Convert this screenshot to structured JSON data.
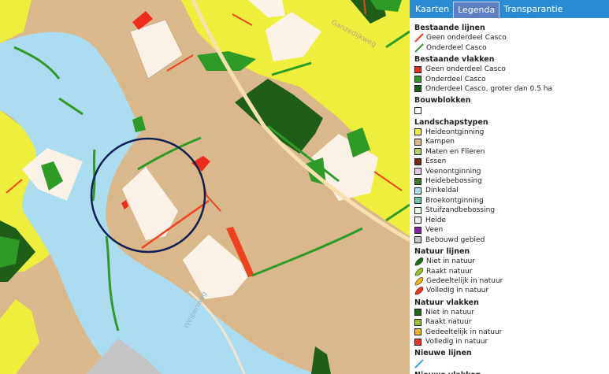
{
  "tabs": [
    {
      "label": "Kaarten",
      "active": false
    },
    {
      "label": "Legenda",
      "active": true
    },
    {
      "label": "Transparantie",
      "active": false
    }
  ],
  "map": {
    "road_labels": [
      "Ganzedijkweg",
      "Welpenweg"
    ],
    "colors": {
      "water": "#acdcf0",
      "kampen": "#d9b98b",
      "heideontginning": "#eeee3c",
      "bouwblok": "#faf2e6",
      "casco_green": "#2f9b27",
      "casco_dark": "#1f6b17",
      "not_casco": "#ef4320",
      "circle": "#0d1f55"
    }
  },
  "legend": {
    "bestaande_lijnen": {
      "title": "Bestaande lijnen",
      "items": [
        {
          "label": "Geen onderdeel Casco",
          "color": "#ef4320"
        },
        {
          "label": "Onderdeel Casco",
          "color": "#2f9b27"
        }
      ]
    },
    "bestaande_vlakken": {
      "title": "Bestaande vlakken",
      "items": [
        {
          "label": "Geen onderdeel Casco",
          "color": "#ef2b1c"
        },
        {
          "label": "Onderdeel Casco",
          "color": "#2f9b27"
        },
        {
          "label": "Onderdeel Casco, groter dan 0.5 ha",
          "color": "#1e5e17"
        }
      ]
    },
    "bouwblokken": {
      "title": "Bouwblokken",
      "items": [
        {
          "label": "",
          "color": "#ffffff"
        }
      ]
    },
    "landschapstypen": {
      "title": "Landschapstypen",
      "items": [
        {
          "label": "Heideontginning",
          "color": "#eeee3c"
        },
        {
          "label": "Kampen",
          "color": "#d9b98b"
        },
        {
          "label": "Maten en Flieren",
          "color": "#b3d16b"
        },
        {
          "label": "Essen",
          "color": "#7a2a14"
        },
        {
          "label": "Veenontginning",
          "color": "#e9c8e6"
        },
        {
          "label": "Heidebebossing",
          "color": "#3d7a2e"
        },
        {
          "label": "Dinkeldal",
          "color": "#acdcf0"
        },
        {
          "label": "Broekontginning",
          "color": "#6fc6a6"
        },
        {
          "label": "Stuifzandbebossing",
          "color": "#eaf6df"
        },
        {
          "label": "Heide",
          "color": "#f5e9f1"
        },
        {
          "label": "Veen",
          "color": "#8c1fb0"
        },
        {
          "label": "Bebouwd gebied",
          "color": "#c4c4c4"
        }
      ]
    },
    "natuur_lijnen": {
      "title": "Natuur lijnen",
      "items": [
        {
          "label": "Niet in natuur",
          "color": "#1f6b17"
        },
        {
          "label": "Raakt natuur",
          "color": "#9ac026"
        },
        {
          "label": "Gedeeltelijk in natuur",
          "color": "#f0b31a"
        },
        {
          "label": "Volledig in natuur",
          "color": "#ef3320"
        }
      ]
    },
    "natuur_vlakken": {
      "title": "Natuur vlakken",
      "items": [
        {
          "label": "Niet in natuur",
          "color": "#1f6b17"
        },
        {
          "label": "Raakt natuur",
          "color": "#9ac026"
        },
        {
          "label": "Gedeeltelijk in natuur",
          "color": "#f0b31a"
        },
        {
          "label": "Volledig in natuur",
          "color": "#ef3320"
        }
      ]
    },
    "nieuwe_lijnen": {
      "title": "Nieuwe lijnen",
      "items": [
        {
          "label": "",
          "color": "#3aa7d6"
        }
      ]
    },
    "nieuwe_vlakken": {
      "title": "Nieuwe vlakken",
      "items": [
        {
          "label": "",
          "color": "#2aa8c8"
        }
      ]
    }
  }
}
